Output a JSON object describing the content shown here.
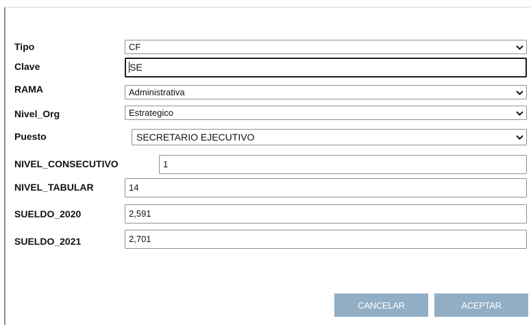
{
  "form": {
    "tipo": {
      "label": "Tipo",
      "value": "CF"
    },
    "clave": {
      "label": "Clave",
      "value": "SE"
    },
    "rama": {
      "label": "RAMA",
      "value": "Administrativa"
    },
    "nivel_org": {
      "label": "Nivel_Org",
      "value": "Estrategico"
    },
    "puesto": {
      "label": "Puesto",
      "value": "SECRETARIO EJECUTIVO"
    },
    "nivel_consecutivo": {
      "label": "NIVEL_CONSECUTIVO",
      "value": "1"
    },
    "nivel_tabular": {
      "label": "NIVEL_TABULAR",
      "value": "14"
    },
    "sueldo_2020": {
      "label": "SUELDO_2020",
      "value": "2,591"
    },
    "sueldo_2021": {
      "label": "SUELDO_2021",
      "value": "2,701"
    }
  },
  "buttons": {
    "cancel": "CANCELAR",
    "accept": "ACEPTAR"
  },
  "icons": {
    "dropdown": "chevron-down-icon"
  },
  "colors": {
    "button_bg": "#92aec4",
    "focus_border": "#1a1a1a"
  }
}
